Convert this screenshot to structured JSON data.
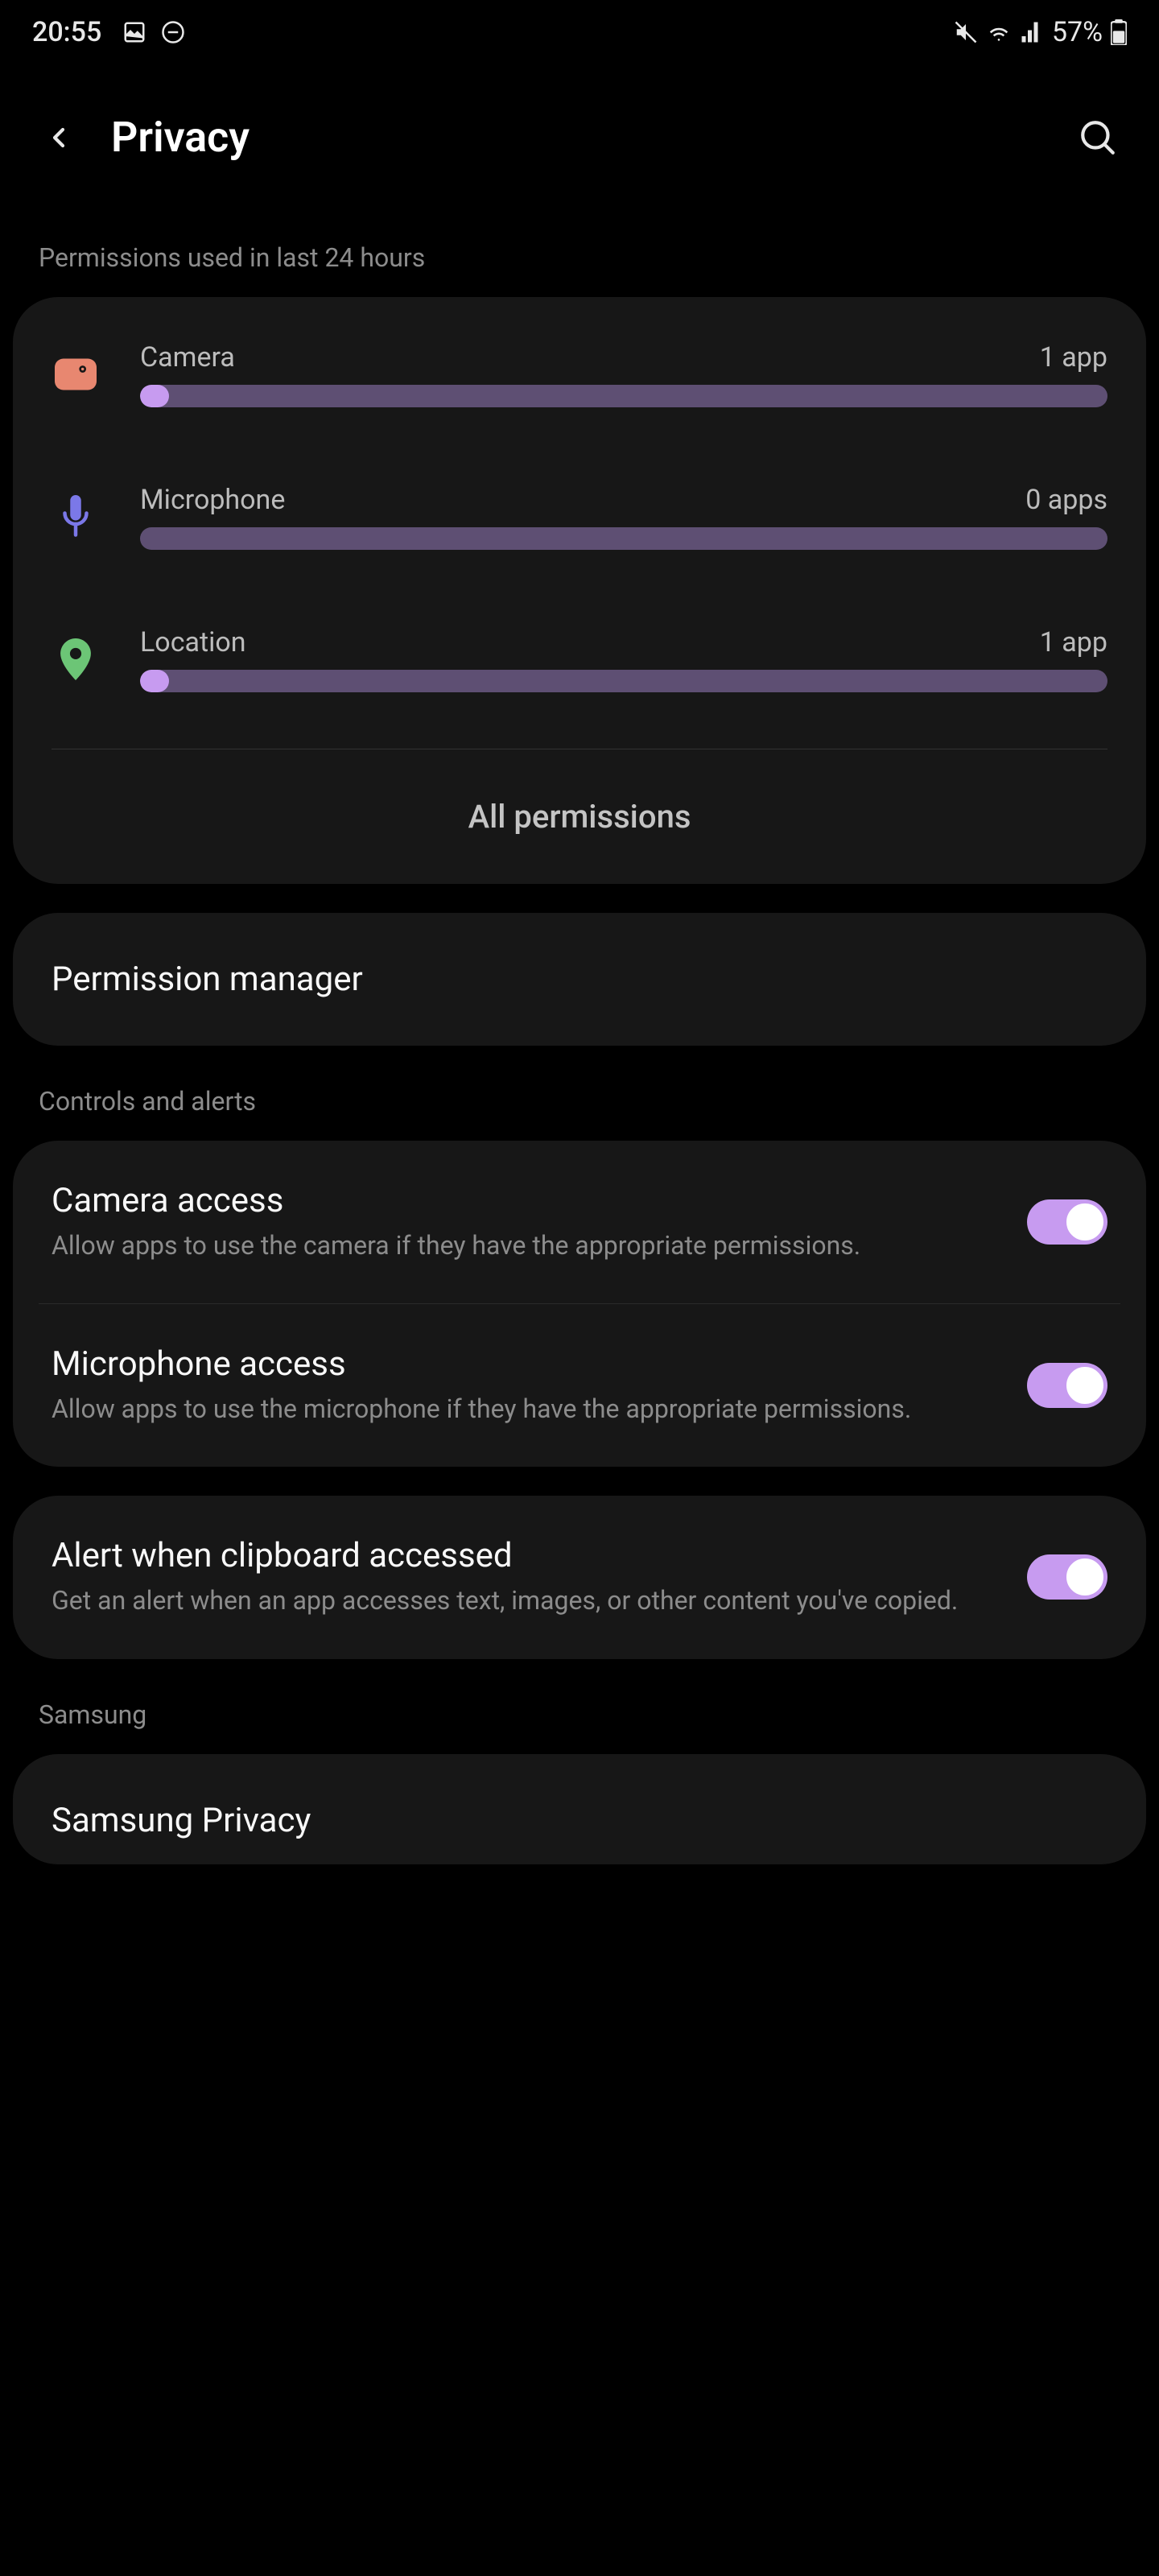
{
  "status": {
    "time": "20:55",
    "battery": "57%"
  },
  "header": {
    "title": "Privacy"
  },
  "sections": {
    "permissions_used": "Permissions used in last 24 hours",
    "controls_alerts": "Controls and alerts",
    "samsung": "Samsung"
  },
  "permissions": [
    {
      "name": "Camera",
      "count": "1 app",
      "fill": 3
    },
    {
      "name": "Microphone",
      "count": "0 apps",
      "fill": 0
    },
    {
      "name": "Location",
      "count": "1 app",
      "fill": 3
    }
  ],
  "all_permissions": "All permissions",
  "permission_manager": "Permission manager",
  "toggles": {
    "camera": {
      "title": "Camera access",
      "desc": "Allow apps to use the camera if they have the appropriate permissions.",
      "on": true
    },
    "microphone": {
      "title": "Microphone access",
      "desc": "Allow apps to use the microphone if they have the appropriate permissions.",
      "on": true
    },
    "clipboard": {
      "title": "Alert when clipboard accessed",
      "desc": "Get an alert when an app accesses text, images, or other content you've copied.",
      "on": true
    }
  },
  "samsung_privacy": "Samsung Privacy"
}
